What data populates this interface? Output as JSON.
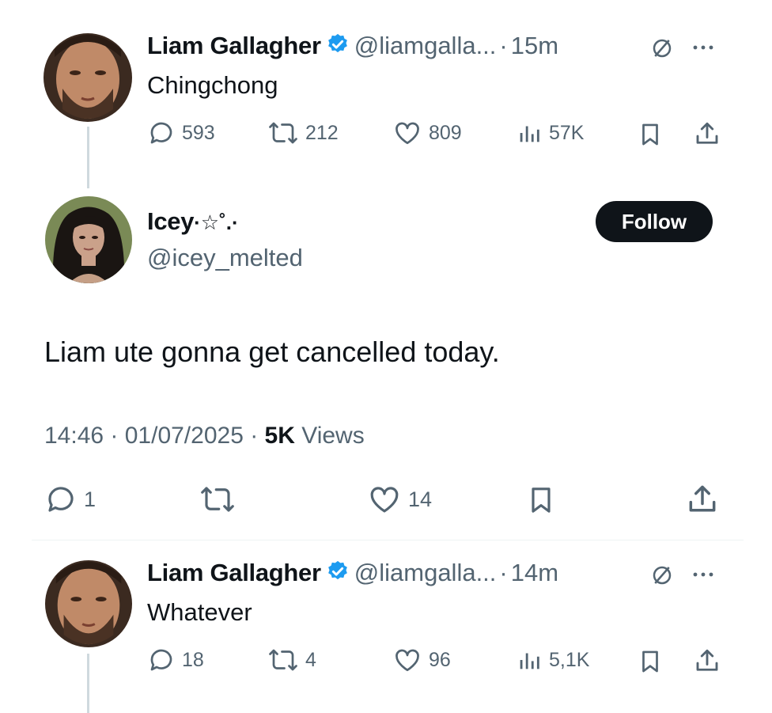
{
  "tweet1": {
    "name": "Liam Gallagher",
    "handle": "@liamgalla...",
    "sep": "·",
    "time": "15m",
    "text": "Chingchong",
    "replies": "593",
    "reposts": "212",
    "likes": "809",
    "views": "57K"
  },
  "main_tweet": {
    "name": "Icey",
    "name_deco": "·☆˚.·",
    "handle": "@icey_melted",
    "follow_label": "Follow",
    "text": "Liam ute gonna get cancelled today.",
    "timestamp": "14:46 · 01/07/2025 · ",
    "views_count": "5K",
    "views_label": " Views",
    "replies": "1",
    "likes": "14"
  },
  "tweet2": {
    "name": "Liam Gallagher",
    "handle": "@liamgalla...",
    "sep": "·",
    "time": "14m",
    "text": "Whatever",
    "replies": "18",
    "reposts": "4",
    "likes": "96",
    "views": "5,1K"
  },
  "colors": {
    "text": "#0f1419",
    "secondary": "#536471",
    "verified": "#1d9bf0",
    "follow_bg": "#0f1419",
    "thread_line": "#cfd9de"
  }
}
